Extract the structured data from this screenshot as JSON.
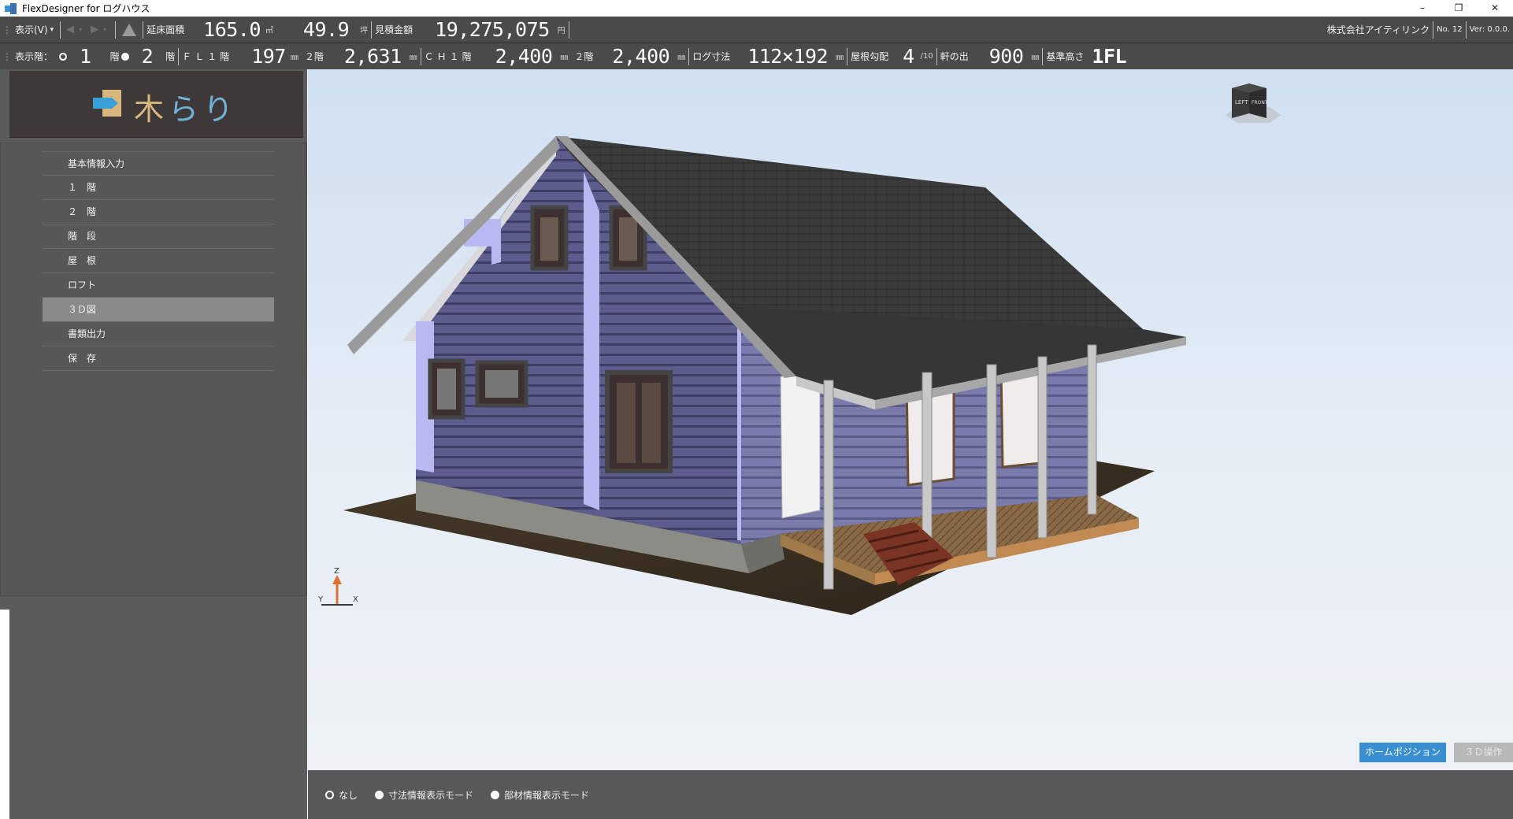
{
  "window": {
    "title": "FlexDesigner for ログハウス",
    "minimize": "–",
    "restore": "❐",
    "close": "✕"
  },
  "toolbar1": {
    "display_menu": "表示(V)",
    "display_menu_caret": "▾",
    "back_icon": "◀",
    "forward_icon": "▶",
    "floor_area_label": "延床面積",
    "floor_area_value": "165.0",
    "floor_area_unit": "㎡",
    "tsubo_value": "49.9",
    "tsubo_unit": "坪",
    "estimate_label": "見積金額",
    "estimate_value": "19,275,075",
    "estimate_unit": "円",
    "company": "株式会社アイティリンク",
    "number": "No. 12",
    "version": "Ver: 0.0.0."
  },
  "toolbar2": {
    "display_floor_label": "表示階：",
    "floor1_value": "1",
    "floor1_unit": "階",
    "floor2_value": "2",
    "floor2_unit": "階",
    "fl_label": "ＦＬ１階",
    "fl1_value": "197",
    "fl1_unit": "㎜",
    "fl2_label": "２階",
    "fl2_value": "2,631",
    "fl2_unit": "㎜",
    "ch_label": "ＣＨ１階",
    "ch1_value": "2,400",
    "ch1_unit": "㎜",
    "ch2_label": "２階",
    "ch2_value": "2,400",
    "ch2_unit": "㎜",
    "log_label": "ログ寸法",
    "log_value": "112×192",
    "log_unit": "㎜",
    "pitch_label": "屋根勾配",
    "pitch_value": "4",
    "pitch_unit": "/10",
    "eave_label": "軒の出",
    "eave_value": "900",
    "eave_unit": "㎜",
    "base_label": "基準高さ",
    "base_value": "1FL"
  },
  "sidebar": {
    "logo_text_1": "木",
    "logo_text_2": "らり",
    "items": [
      {
        "label": "基本情報入力"
      },
      {
        "label": "１　階"
      },
      {
        "label": "２　階"
      },
      {
        "label": "階　段"
      },
      {
        "label": "屋　根"
      },
      {
        "label": "ロフト"
      },
      {
        "label": "３Ｄ図"
      },
      {
        "label": "書類出力"
      },
      {
        "label": "保　存"
      }
    ],
    "active_index": 6
  },
  "viewport": {
    "nav_cube_left": "LEFT",
    "nav_cube_front": "FRONT",
    "axis_z": "Z",
    "axis_y": "Y",
    "axis_x": "X",
    "home_button": "ホームポジション",
    "operation_button": "３Ｄ操作"
  },
  "bottom": {
    "modes": [
      {
        "label": "なし",
        "selected": true
      },
      {
        "label": "寸法情報表示モード",
        "selected": false
      },
      {
        "label": "部材情報表示モード",
        "selected": false
      }
    ]
  },
  "colors": {
    "toolbar_bg": "#4a4a4a",
    "sidebar_bg": "#5b5b5b",
    "accent_blue": "#3a8fd0",
    "wall_purple": "#5e5f8e",
    "roof_dark": "#3a3a3a"
  }
}
